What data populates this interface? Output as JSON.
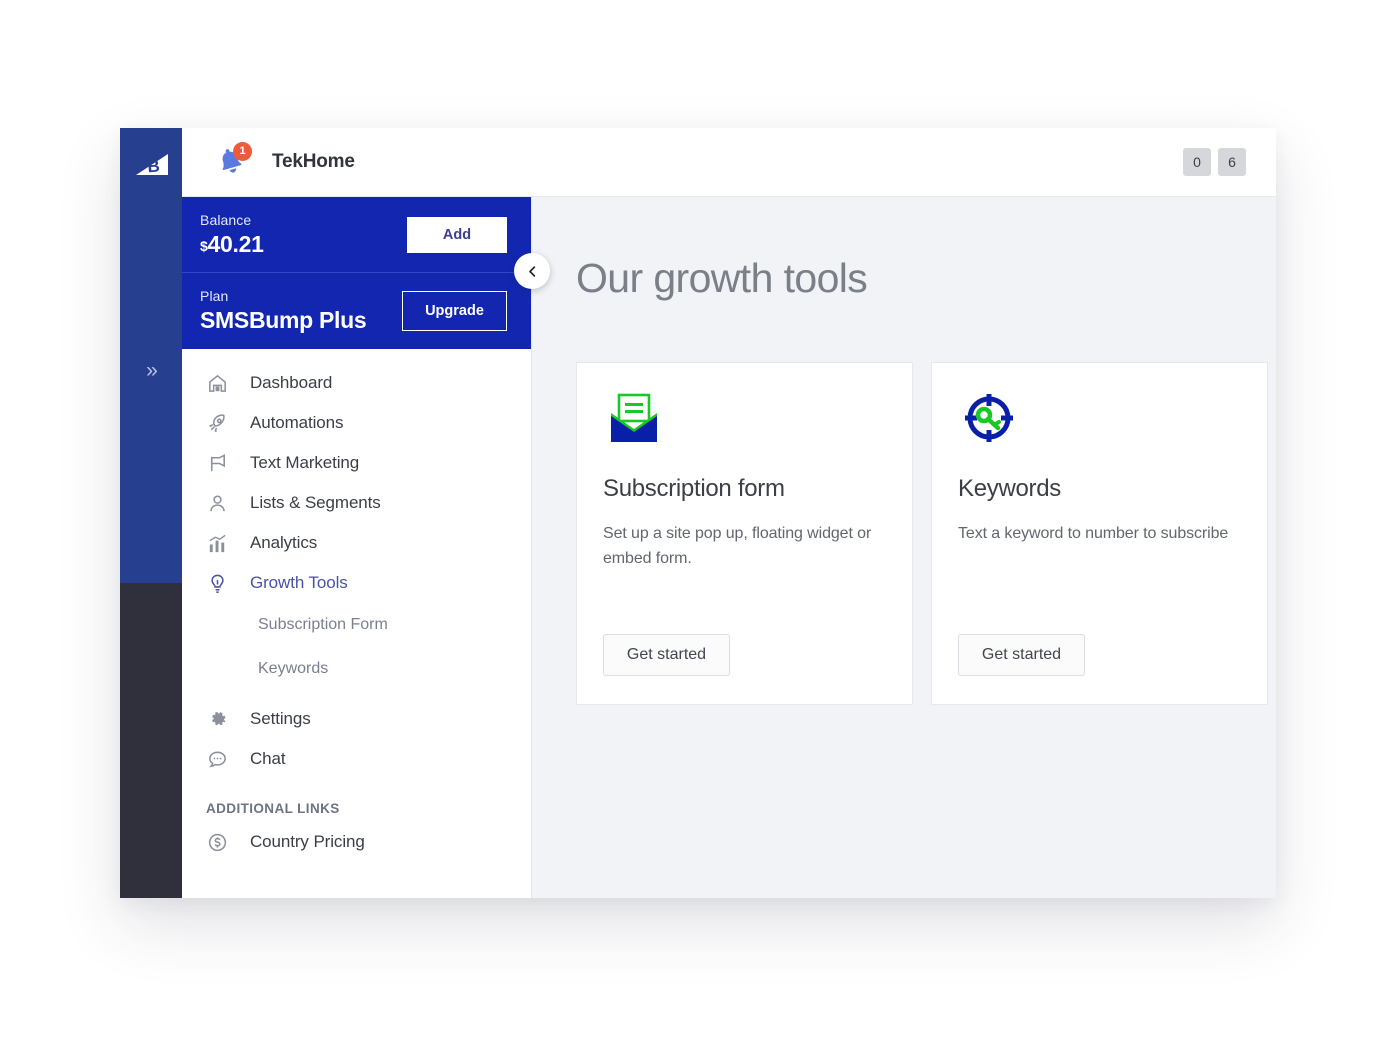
{
  "rail": {
    "logo_icon": "bsb-logo-icon",
    "expand_icon": "double-chevron-right-icon",
    "expand_label": "»"
  },
  "header": {
    "bell_icon": "notification-bell-icon",
    "notification_count": "1",
    "store_name": "TekHome",
    "counters": [
      {
        "name": "counter-zero",
        "value": "0"
      },
      {
        "name": "counter-six",
        "value": "6"
      }
    ]
  },
  "account": {
    "balance_label": "Balance",
    "balance_currency": "$",
    "balance_amount": "40.21",
    "add_button": "Add",
    "plan_label": "Plan",
    "plan_name": "SMSBump Plus",
    "upgrade_button": "Upgrade"
  },
  "sidebar": {
    "items": [
      {
        "label": "Dashboard",
        "icon": "home-icon",
        "active": false
      },
      {
        "label": "Automations",
        "icon": "rocket-icon",
        "active": false
      },
      {
        "label": "Text Marketing",
        "icon": "megaphone-icon",
        "active": false
      },
      {
        "label": "Lists & Segments",
        "icon": "person-icon",
        "active": false
      },
      {
        "label": "Analytics",
        "icon": "bar-chart-icon",
        "active": false
      },
      {
        "label": "Growth Tools",
        "icon": "lightbulb-icon",
        "active": true
      }
    ],
    "sub_items": [
      {
        "label": "Subscription Form"
      },
      {
        "label": "Keywords"
      }
    ],
    "items_secondary": [
      {
        "label": "Settings",
        "icon": "gear-icon"
      },
      {
        "label": "Chat",
        "icon": "chat-bubble-icon"
      }
    ],
    "additional_links_title": "ADDITIONAL LINKS",
    "additional_links": [
      {
        "label": "Country Pricing",
        "icon": "dollar-circle-icon"
      }
    ],
    "collapse_icon": "chevron-left-icon"
  },
  "main": {
    "page_title": "Our growth tools",
    "cards": [
      {
        "icon": "open-envelope-icon",
        "title": "Subscription form",
        "description": "Set up a site pop up, floating widget or embed form.",
        "button": "Get started"
      },
      {
        "icon": "target-key-icon",
        "title": "Keywords",
        "description": "Text a keyword to number to subscribe",
        "button": "Get started"
      }
    ]
  },
  "colors": {
    "rail_blue": "#26408f",
    "rail_dark": "#2f303c",
    "account_blue": "#1226b0",
    "accent_purple": "#4a52a5",
    "badge_red": "#ef5a3c",
    "icon_green": "#18c925",
    "icon_blue": "#0a1fa8",
    "main_bg": "#f1f3f6"
  }
}
